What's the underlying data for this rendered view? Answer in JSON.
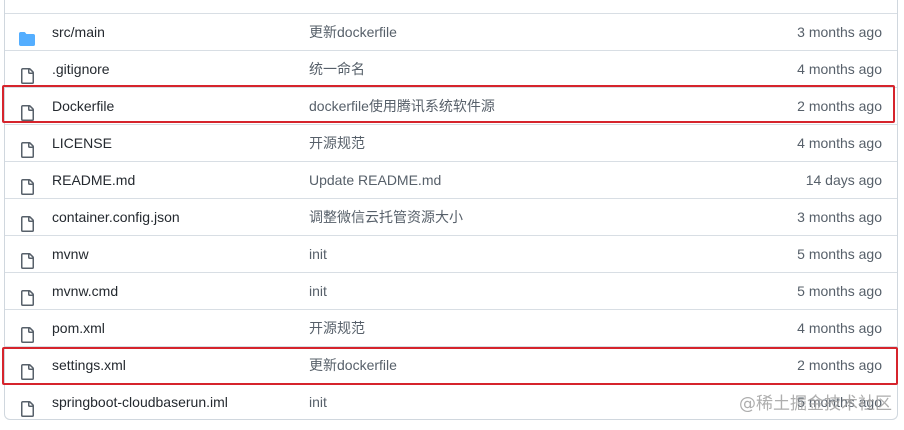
{
  "files": [
    {
      "name": "src/main",
      "type": "folder",
      "icon": "folder-icon",
      "message": "更新dockerfile",
      "age": "3 months ago"
    },
    {
      "name": ".gitignore",
      "type": "file",
      "icon": "file-icon",
      "message": "统一命名",
      "age": "4 months ago"
    },
    {
      "name": "Dockerfile",
      "type": "file",
      "icon": "file-icon",
      "message": "dockerfile使用腾讯系统软件源",
      "age": "2 months ago"
    },
    {
      "name": "LICENSE",
      "type": "file",
      "icon": "file-icon",
      "message": "开源规范",
      "age": "4 months ago"
    },
    {
      "name": "README.md",
      "type": "file",
      "icon": "file-icon",
      "message": "Update README.md",
      "age": "14 days ago"
    },
    {
      "name": "container.config.json",
      "type": "file",
      "icon": "file-icon",
      "message": "调整微信云托管资源大小",
      "age": "3 months ago"
    },
    {
      "name": "mvnw",
      "type": "file",
      "icon": "file-icon",
      "message": "init",
      "age": "5 months ago"
    },
    {
      "name": "mvnw.cmd",
      "type": "file",
      "icon": "file-icon",
      "message": "init",
      "age": "5 months ago"
    },
    {
      "name": "pom.xml",
      "type": "file",
      "icon": "file-icon",
      "message": "开源规范",
      "age": "4 months ago"
    },
    {
      "name": "settings.xml",
      "type": "file",
      "icon": "file-icon",
      "message": "更新dockerfile",
      "age": "2 months ago"
    },
    {
      "name": "springboot-cloudbaserun.iml",
      "type": "file",
      "icon": "file-icon",
      "message": "init",
      "age": "5 months ago"
    }
  ],
  "highlighted_files": [
    "Dockerfile",
    "settings.xml"
  ],
  "watermark": "@稀土掘金技术社区",
  "colors": {
    "folder": "#54aeff",
    "file_icon": "#57606a",
    "highlight": "#d6242c",
    "border": "#d0d7de"
  }
}
